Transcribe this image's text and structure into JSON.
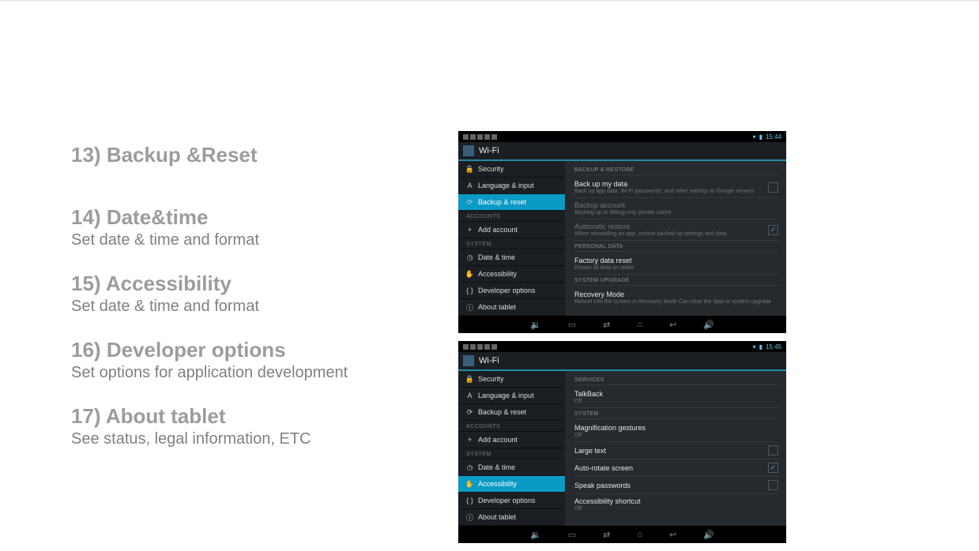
{
  "sections": [
    {
      "num": "13)",
      "title": "Backup &Reset",
      "desc": null
    },
    {
      "num": "14)",
      "title": "Date&time",
      "desc": "Set date & time and format"
    },
    {
      "num": "15)",
      "title": "Accessibility",
      "desc": "Set date & time and format"
    },
    {
      "num": "16)",
      "title": "Developer options",
      "desc": "Set options for application development"
    },
    {
      "num": "17)",
      "title": "About tablet",
      "desc": "See status, legal information, ETC"
    }
  ],
  "shot1": {
    "time": "15:44",
    "app": "Wi-Fi",
    "sidebar": {
      "items_top": [
        {
          "icon": "🔒",
          "label": "Security"
        },
        {
          "icon": "A",
          "label": "Language & input"
        },
        {
          "icon": "⟳",
          "label": "Backup & reset",
          "selected": true
        }
      ],
      "head1": "ACCOUNTS",
      "items_acc": [
        {
          "icon": "+",
          "label": "Add account"
        }
      ],
      "head2": "SYSTEM",
      "items_sys": [
        {
          "icon": "◷",
          "label": "Date & time"
        },
        {
          "icon": "✋",
          "label": "Accessibility"
        },
        {
          "icon": "{ }",
          "label": "Developer options"
        },
        {
          "icon": "ⓘ",
          "label": "About tablet"
        }
      ]
    },
    "panel": {
      "g1_head": "BACKUP & RESTORE",
      "g1": [
        {
          "t": "Back up my data",
          "s": "Back up app data, Wi-Fi passwords, and other settings to Google servers",
          "chk": "off"
        },
        {
          "t": "Backup account",
          "s": "Backing up to debug-only private cache",
          "dim": true
        },
        {
          "t": "Automatic restore",
          "s": "When reinstalling an app, restore backed up settings and data",
          "dim": true,
          "chk": "on"
        }
      ],
      "g2_head": "PERSONAL DATA",
      "g2": [
        {
          "t": "Factory data reset",
          "s": "Erases all data on tablet"
        }
      ],
      "g3_head": "SYSTEM UPGRADE",
      "g3": [
        {
          "t": "Recovery Mode",
          "s": "Reboot into the system in Recovery Mode.Can clear the data or system upgrade"
        }
      ]
    }
  },
  "shot2": {
    "time": "15:45",
    "app": "Wi-Fi",
    "sidebar": {
      "items_top": [
        {
          "icon": "🔒",
          "label": "Security"
        },
        {
          "icon": "A",
          "label": "Language & input"
        },
        {
          "icon": "⟳",
          "label": "Backup & reset"
        }
      ],
      "head1": "ACCOUNTS",
      "items_acc": [
        {
          "icon": "+",
          "label": "Add account"
        }
      ],
      "head2": "SYSTEM",
      "items_sys": [
        {
          "icon": "◷",
          "label": "Date & time"
        },
        {
          "icon": "✋",
          "label": "Accessibility",
          "selected": true
        },
        {
          "icon": "{ }",
          "label": "Developer options"
        },
        {
          "icon": "ⓘ",
          "label": "About tablet"
        }
      ]
    },
    "panel": {
      "g1_head": "SERVICES",
      "g1": [
        {
          "t": "TalkBack",
          "s": "Off"
        }
      ],
      "g2_head": "SYSTEM",
      "g2": [
        {
          "t": "Magnification gestures",
          "s": "Off"
        },
        {
          "t": "Large text",
          "chk": "off"
        },
        {
          "t": "Auto-rotate screen",
          "chk": "on"
        },
        {
          "t": "Speak passwords",
          "chk": "off"
        },
        {
          "t": "Accessibility shortcut",
          "s": "Off"
        }
      ]
    }
  },
  "nav_icons": [
    "🔉",
    "▭",
    "⇄",
    "⌂",
    "↩",
    "🔊"
  ]
}
